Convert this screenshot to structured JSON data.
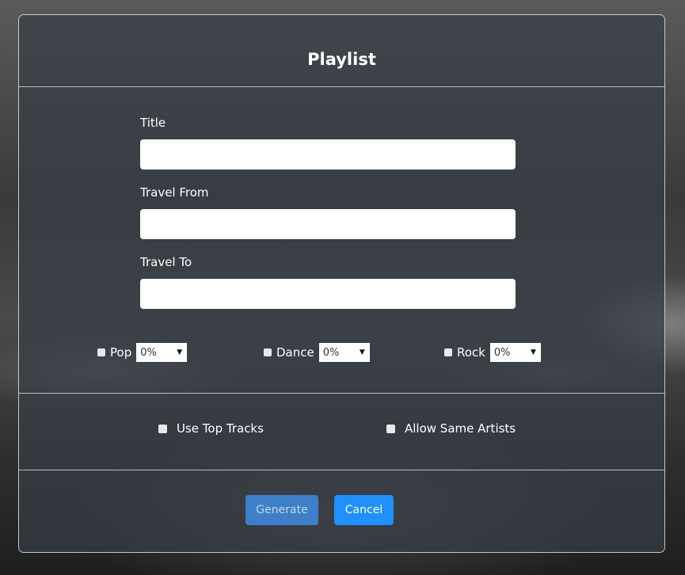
{
  "dialog": {
    "title": "Playlist"
  },
  "fields": {
    "title_label": "Title",
    "title_value": "",
    "travel_from_label": "Travel From",
    "travel_from_value": "",
    "travel_to_label": "Travel To",
    "travel_to_value": ""
  },
  "genres": [
    {
      "label": "Pop",
      "percent": "0%",
      "checked": false
    },
    {
      "label": "Dance",
      "percent": "0%",
      "checked": false
    },
    {
      "label": "Rock",
      "percent": "0%",
      "checked": false
    }
  ],
  "options": {
    "use_top_tracks": "Use Top Tracks",
    "allow_same_artists": "Allow Same Artists"
  },
  "buttons": {
    "generate": "Generate",
    "cancel": "Cancel"
  },
  "colors": {
    "generate": "#3d7fc9",
    "cancel": "#1e90ff"
  }
}
